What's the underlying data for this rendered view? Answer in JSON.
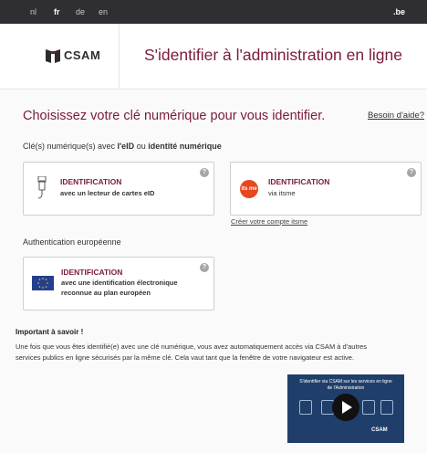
{
  "topbar": {
    "languages": [
      {
        "label": "nl"
      },
      {
        "label": "fr"
      },
      {
        "label": "de"
      },
      {
        "label": "en"
      }
    ],
    "active_language": "fr",
    "domain": ".be"
  },
  "header": {
    "logo_text": "CSAM",
    "title": "S'identifier à l'administration en ligne"
  },
  "main": {
    "heading": "Choisissez votre clé numérique pour vous identifier.",
    "help_link": "Besoin d'aide?",
    "subheading_prefix": "Clé(s) numérique(s) avec ",
    "subheading_eid": "l'eID",
    "subheading_or": " ou ",
    "subheading_identity": "identité numérique",
    "cards": [
      {
        "title": "IDENTIFICATION",
        "description": "avec un lecteur de cartes eID",
        "help": "?"
      },
      {
        "title": "IDENTIFICATION",
        "description": "via itsme",
        "help": "?"
      }
    ],
    "itsme_logo": "its me",
    "create_account_link": "Créer votre compte itsme",
    "european_heading": "Authentication européenne",
    "eu_card": {
      "title": "IDENTIFICATION",
      "description": "avec une identification électronique reconnue au plan européen",
      "help": "?"
    },
    "important_title": "Important à savoir !",
    "important_text": "Une fois que vous êtes identifié(e) avec une clé numérique, vous avez automatiquement accès via CSAM à d'autres services publics en ligne sécurisés par la même clé. Cela vaut tant que la fenêtre de votre navigateur est active."
  },
  "video": {
    "caption": "S'identifier via CSAM sur les services en ligne de l'Administration",
    "logo_text": "CSAM"
  },
  "colors": {
    "brand": "#7a1b3a",
    "topbar": "#2e2e33",
    "itsme": "#e8461e",
    "eu_flag": "#243f8f",
    "video_bg": "#1f3f6a"
  }
}
